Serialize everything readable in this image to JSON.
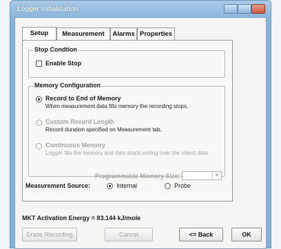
{
  "window": {
    "title": "Logger Initialization"
  },
  "tabs": [
    {
      "label": "Setup",
      "active": true
    },
    {
      "label": "Measurement",
      "active": false
    },
    {
      "label": "Alarms",
      "active": false
    },
    {
      "label": "Properties",
      "active": false
    }
  ],
  "stop_condition": {
    "group_label": "Stop Condtion",
    "enable_stop_label": "Enable Stop",
    "enable_stop_checked": false
  },
  "memory": {
    "group_label": "Memory Configuration",
    "options": [
      {
        "label": "Record to End of Memory",
        "description": "When measurement data fills memory the recording stops.",
        "selected": true,
        "enabled": true
      },
      {
        "label": "Custom Record Length",
        "description": "Record duration specified on Measurement tab.",
        "selected": false,
        "enabled": false
      },
      {
        "label": "Continuous Memory",
        "description": "Logger fills the memory and then starts writing over the oldest data.",
        "selected": false,
        "enabled": false
      }
    ],
    "programmable_label": "Programmable Memory Size:",
    "programmable_value": ""
  },
  "measurement_source": {
    "label": "Measurement Source:",
    "options": [
      {
        "label": "Internal",
        "selected": true
      },
      {
        "label": "Probe",
        "selected": false
      }
    ]
  },
  "mkt_text": "MKT Activation Energy = 83.144 kJ/mole",
  "buttons": {
    "erase": "Erase Recording",
    "cancel": "Cancel",
    "back": "<= Back",
    "ok": "OK"
  }
}
